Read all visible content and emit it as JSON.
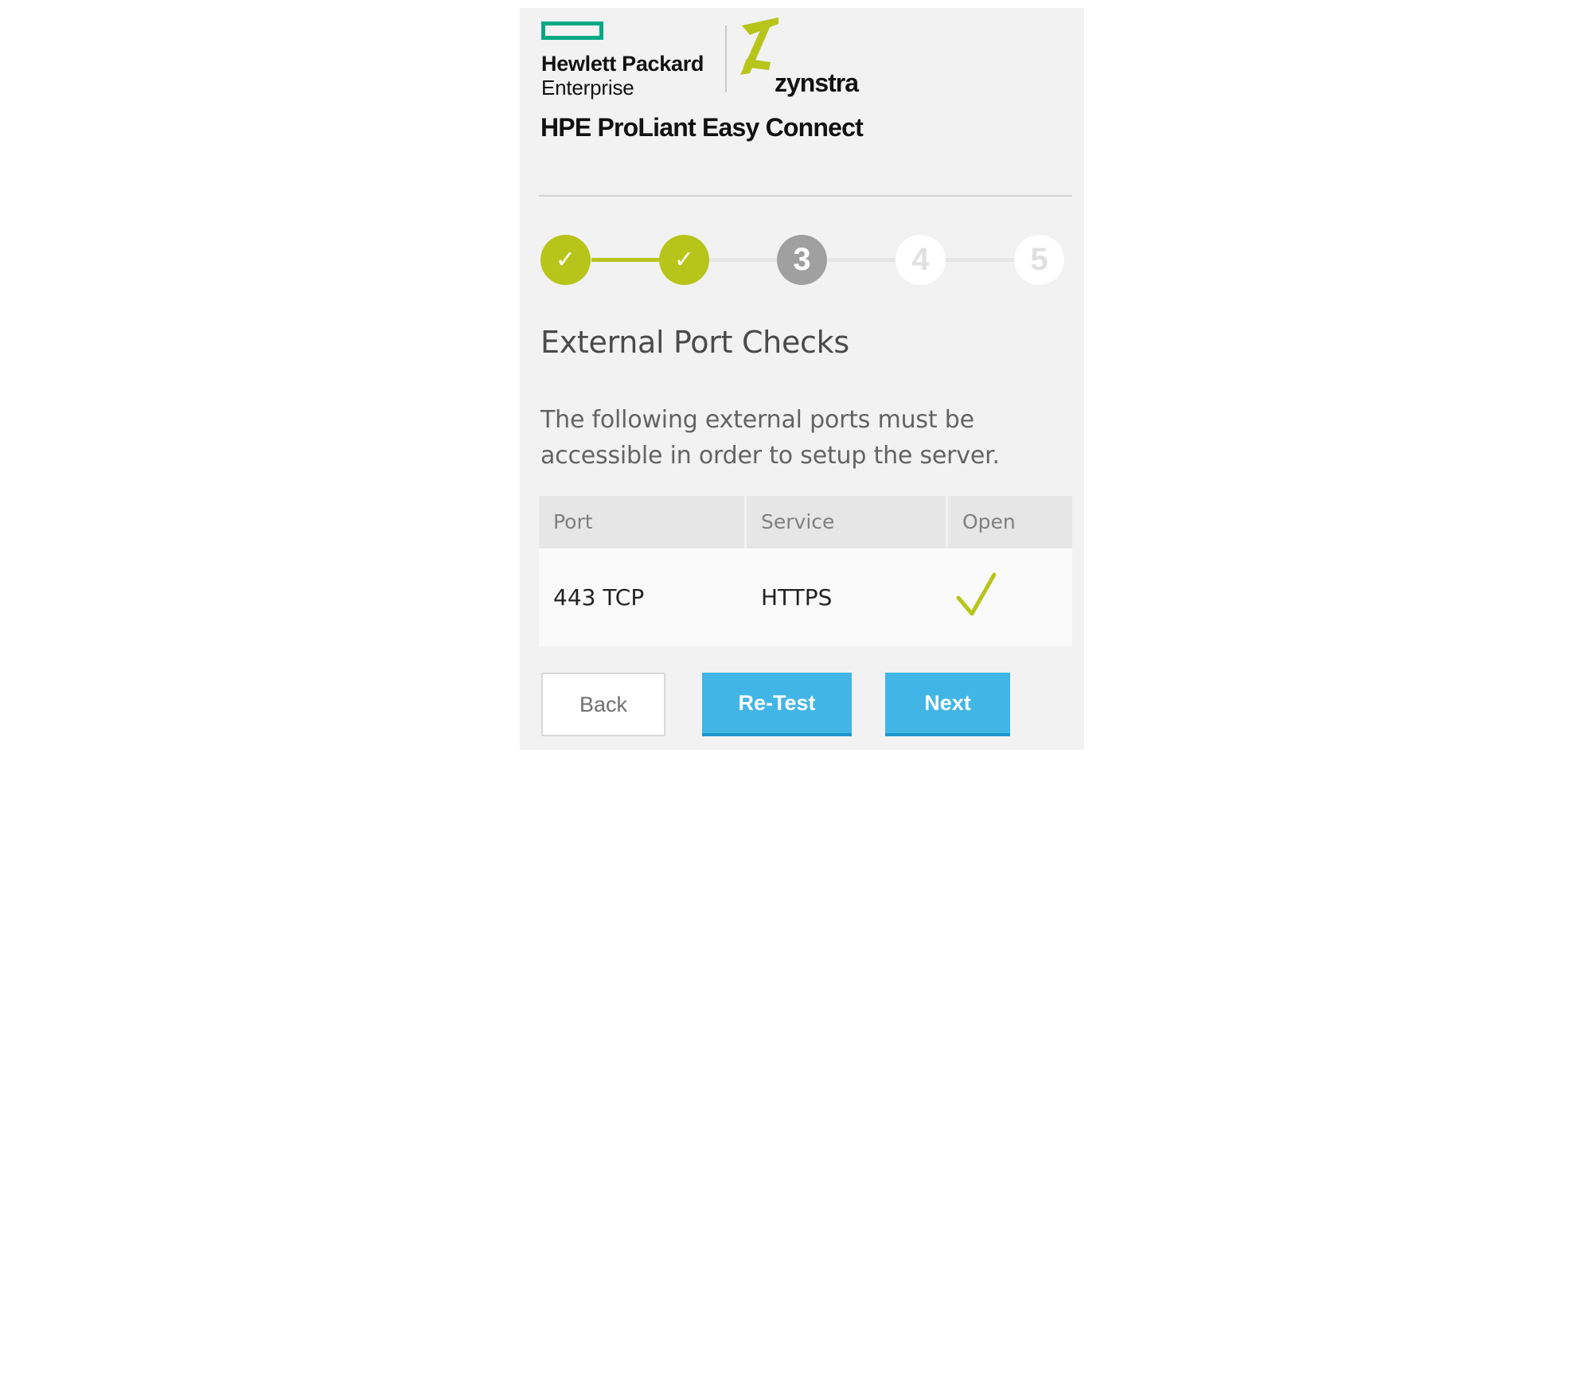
{
  "brand": {
    "hpe_line1": "Hewlett Packard",
    "hpe_line2": "Enterprise",
    "partner_name": "zynstra",
    "app_title": "HPE ProLiant Easy Connect",
    "hpe_green": "#01a982",
    "accent_lime": "#b7c51a",
    "accent_blue": "#41b6e6"
  },
  "stepper": {
    "current_step": 3,
    "total_steps": 5,
    "steps": [
      {
        "label": "✓",
        "state": "done"
      },
      {
        "label": "✓",
        "state": "done"
      },
      {
        "label": "3",
        "state": "current"
      },
      {
        "label": "4",
        "state": "todo"
      },
      {
        "label": "5",
        "state": "todo"
      }
    ]
  },
  "page": {
    "heading": "External Port Checks",
    "description": "The following external ports must be accessible in order to setup the server."
  },
  "table": {
    "headers": {
      "port": "Port",
      "service": "Service",
      "open": "Open"
    },
    "rows": [
      {
        "port": "443 TCP",
        "service": "HTTPS",
        "open": true,
        "open_icon": "checkmark-icon"
      }
    ]
  },
  "buttons": {
    "back": "Back",
    "retest": "Re-Test",
    "next": "Next"
  }
}
